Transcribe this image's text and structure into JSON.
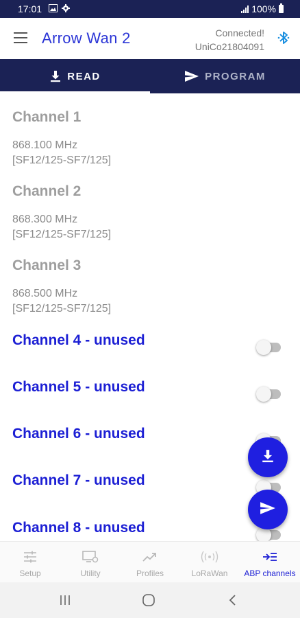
{
  "status_bar": {
    "time": "17:01",
    "battery": "100%"
  },
  "app_bar": {
    "title": "Arrow Wan 2",
    "connection_status": "Connected!",
    "device_id": "UniCo21804091"
  },
  "tabs": [
    {
      "label": "READ",
      "active": true,
      "icon": "download-icon"
    },
    {
      "label": "PROGRAM",
      "active": false,
      "icon": "send-icon"
    }
  ],
  "channels": [
    {
      "title": "Channel 1",
      "frequency": "868.100 MHz",
      "datarate": "[SF12/125-SF7/125]"
    },
    {
      "title": "Channel 2",
      "frequency": "868.300 MHz",
      "datarate": "[SF12/125-SF7/125]"
    },
    {
      "title": "Channel 3",
      "frequency": "868.500 MHz",
      "datarate": "[SF12/125-SF7/125]"
    }
  ],
  "unused_channels": [
    {
      "label": "Channel 4 - unused",
      "enabled": false
    },
    {
      "label": "Channel 5 - unused",
      "enabled": false
    },
    {
      "label": "Channel 6 - unused",
      "enabled": false
    },
    {
      "label": "Channel 7 - unused",
      "enabled": false
    },
    {
      "label": "Channel 8 - unused",
      "enabled": false
    }
  ],
  "fabs": {
    "download_icon": "download-icon",
    "send_icon": "send-icon"
  },
  "bottom_nav": [
    {
      "label": "Setup",
      "icon": "sliders-icon",
      "active": false
    },
    {
      "label": "Utility",
      "icon": "monitor-settings-icon",
      "active": false
    },
    {
      "label": "Profiles",
      "icon": "trending-icon",
      "active": false
    },
    {
      "label": "LoRaWan",
      "icon": "radio-waves-icon",
      "active": false
    },
    {
      "label": "ABP channels",
      "icon": "arrow-list-icon",
      "active": true
    }
  ],
  "colors": {
    "primary_dark": "#1b2255",
    "accent_blue": "#1c1fd4",
    "title_blue": "#2b35d6",
    "bluetooth": "#1a8fe0",
    "grey_text": "#9e9e9e"
  }
}
